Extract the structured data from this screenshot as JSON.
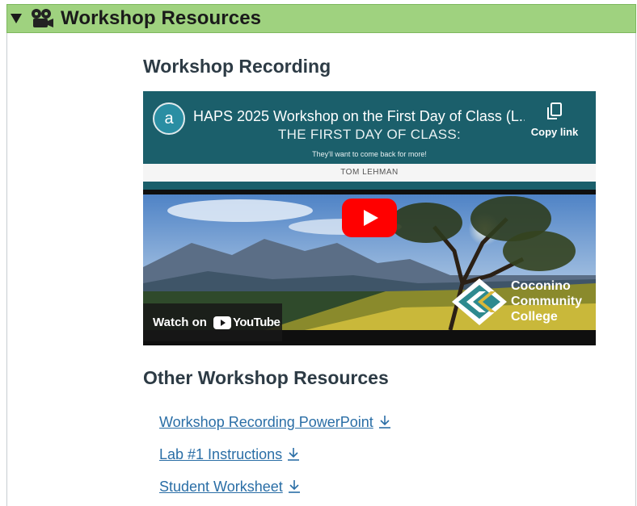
{
  "section": {
    "title": "Workshop Resources",
    "expand_icon": "triangle-down-icon",
    "title_icon": "film-projector-icon"
  },
  "recording": {
    "heading": "Workshop Recording",
    "video": {
      "channel_initial": "a",
      "title": "HAPS 2025 Workshop on the First Day of Class (L...",
      "copy_link_label": "Copy link",
      "slide_title": "THE FIRST DAY OF CLASS:",
      "slide_subtitle": "They'll want to come back for more!",
      "slide_author": "TOM LEHMAN",
      "college_name": "Coconino Community College",
      "watch_on_label": "Watch on",
      "youtube_label": "YouTube",
      "colors": {
        "slide_teal": "#1b5f6b",
        "play_red": "#ff0000"
      }
    }
  },
  "other": {
    "heading": "Other Workshop Resources",
    "links": [
      {
        "label": "Workshop Recording PowerPoint",
        "icon": "download-icon"
      },
      {
        "label": "Lab #1 Instructions",
        "icon": "download-icon"
      },
      {
        "label": "Student Worksheet",
        "icon": "download-icon"
      }
    ]
  },
  "colors": {
    "header_green": "#9fd27f",
    "link_blue": "#2a6ea6",
    "heading_text": "#2d3b45"
  }
}
